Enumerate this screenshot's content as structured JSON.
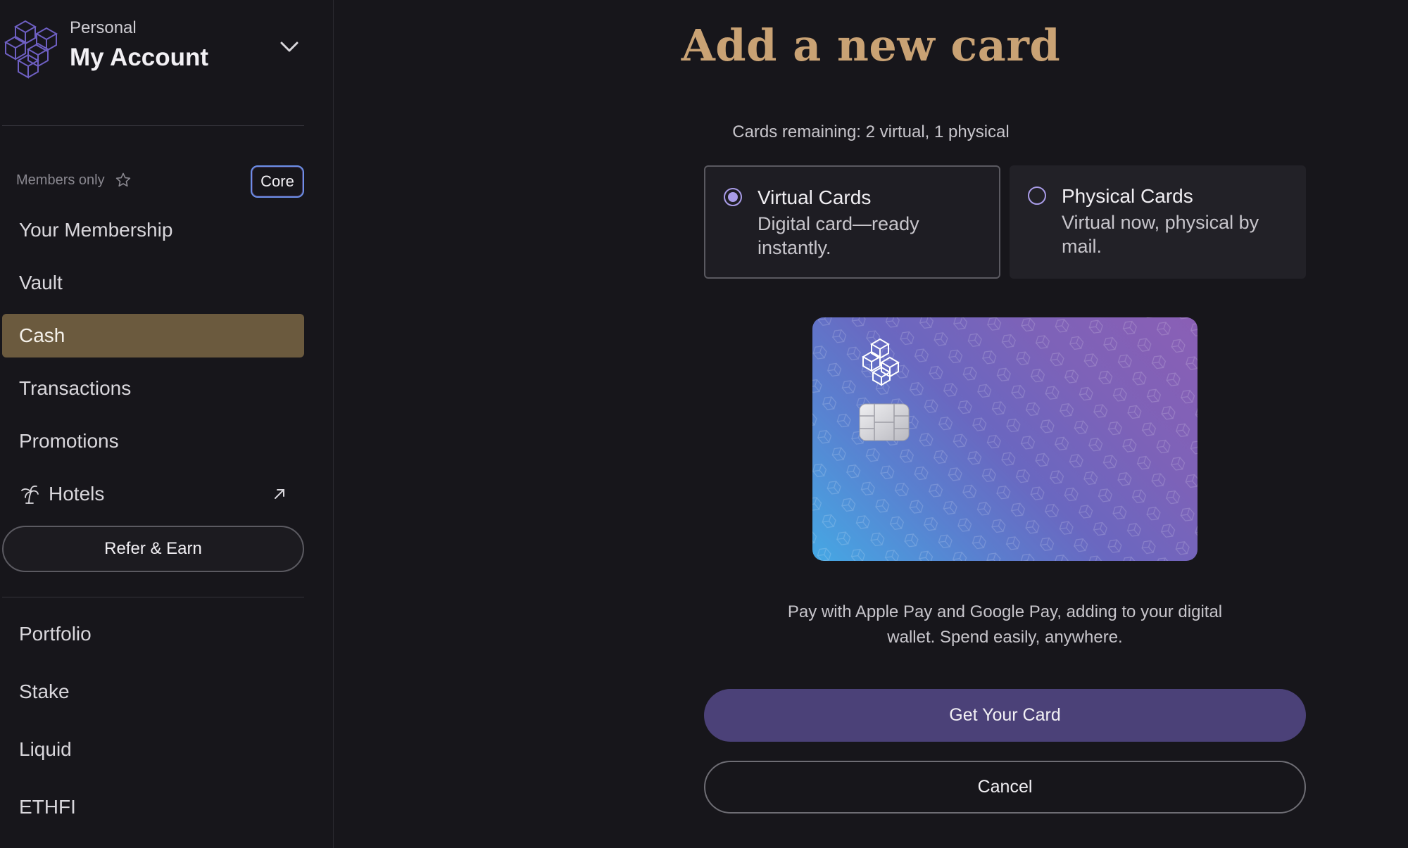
{
  "account": {
    "subtitle": "Personal",
    "title": "My Account"
  },
  "sidebar": {
    "members_label": "Members only",
    "tier_badge": "Core",
    "items": [
      {
        "label": "Your Membership",
        "active": false
      },
      {
        "label": "Vault",
        "active": false
      },
      {
        "label": "Cash",
        "active": true
      },
      {
        "label": "Transactions",
        "active": false
      },
      {
        "label": "Promotions",
        "active": false
      },
      {
        "label": "Hotels",
        "active": false
      }
    ],
    "refer_label": "Refer & Earn",
    "lower_items": [
      {
        "label": "Portfolio"
      },
      {
        "label": "Stake"
      },
      {
        "label": "Liquid"
      },
      {
        "label": "ETHFI"
      }
    ]
  },
  "main": {
    "heading": "Add a new card",
    "remaining": "Cards remaining: 2 virtual, 1 physical",
    "options": [
      {
        "title": "Virtual Cards",
        "description": "Digital card—ready instantly.",
        "selected": true
      },
      {
        "title": "Physical Cards",
        "description": "Virtual now, physical by mail.",
        "selected": false
      }
    ],
    "description": "Pay with Apple Pay and Google Pay, adding to your digital wallet. Spend easily, anywhere.",
    "primary_button": "Get Your Card",
    "cancel_button": "Cancel"
  },
  "colors": {
    "background": "#17161b",
    "accent_gold": "#c9a274",
    "active_nav": "#6b5a3e",
    "primary_button": "#4b4178",
    "radio": "#a99ce8"
  },
  "icons": {
    "logo": "cube-chain-logo-icon",
    "account_toggle": "chevron-down-icon",
    "members": "star-icon",
    "hotels": "palm-tree-icon",
    "hotels_link": "external-arrow-icon"
  }
}
